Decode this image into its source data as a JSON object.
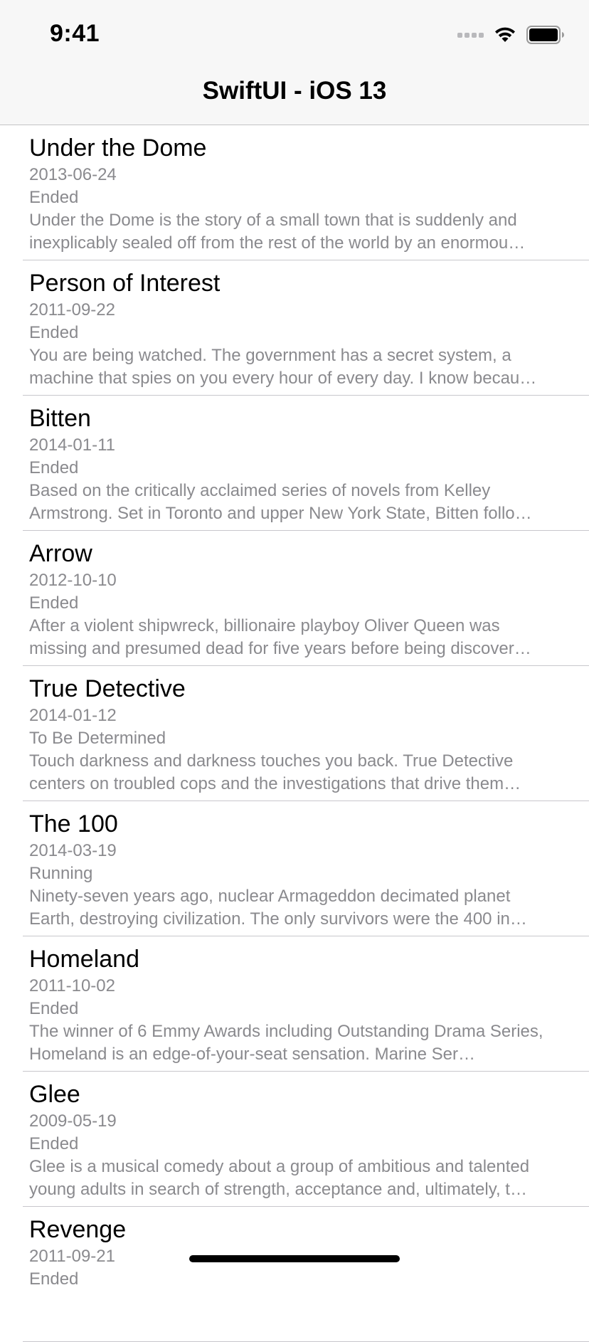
{
  "status_bar": {
    "time": "9:41",
    "icons": [
      "signal-icon",
      "wifi-icon",
      "battery-icon"
    ]
  },
  "nav": {
    "title": "SwiftUI - iOS 13"
  },
  "shows": [
    {
      "title": "Under the Dome",
      "date": "2013-06-24",
      "status": "Ended",
      "summary": "Under the Dome is the story of a small town that is suddenly and inexplicably sealed off from the rest of the world by an enormou…"
    },
    {
      "title": "Person of Interest",
      "date": "2011-09-22",
      "status": "Ended",
      "summary": "You are being watched. The government has a secret system, a machine that spies on you every hour of every day. I know becau…"
    },
    {
      "title": "Bitten",
      "date": "2014-01-11",
      "status": "Ended",
      "summary": "Based on the critically acclaimed series of novels from Kelley Armstrong. Set in Toronto and upper New York State, Bitten follo…"
    },
    {
      "title": "Arrow",
      "date": "2012-10-10",
      "status": "Ended",
      "summary": "After a violent shipwreck, billionaire playboy Oliver Queen was missing and presumed dead for five years before being discover…"
    },
    {
      "title": "True Detective",
      "date": "2014-01-12",
      "status": "To Be Determined",
      "summary": "Touch darkness and darkness touches you back. True Detective centers on troubled cops and the investigations that drive them…"
    },
    {
      "title": "The 100",
      "date": "2014-03-19",
      "status": "Running",
      "summary": "Ninety-seven years ago, nuclear Armageddon decimated planet Earth, destroying civilization. The only survivors were the 400 in…"
    },
    {
      "title": "Homeland",
      "date": "2011-10-02",
      "status": "Ended",
      "summary": "The winner of 6 Emmy Awards including Outstanding Drama Series, Homeland is an edge-of-your-seat sensation. Marine Ser…"
    },
    {
      "title": "Glee",
      "date": "2009-05-19",
      "status": "Ended",
      "summary": "Glee is a musical comedy about a group of ambitious and talented young adults in search of strength, acceptance and, ultimately, t…"
    },
    {
      "title": "Revenge",
      "date": "2011-09-21",
      "status": "Ended",
      "summary": ""
    }
  ]
}
